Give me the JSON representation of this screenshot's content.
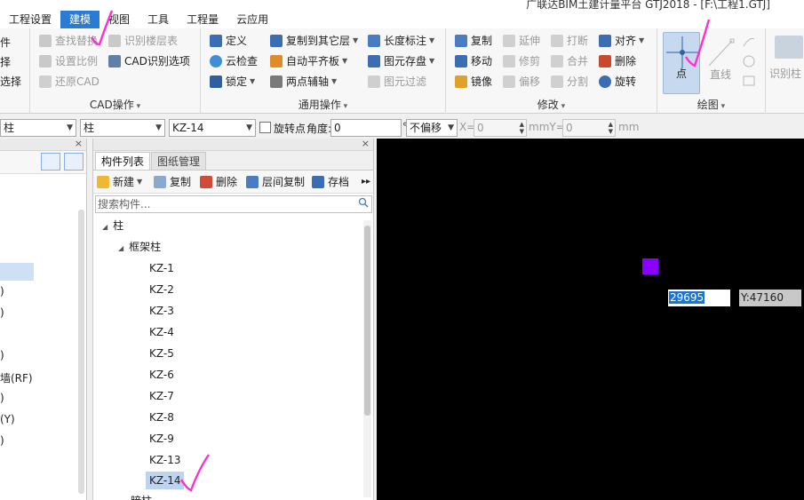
{
  "window": {
    "title": "广联达BIM土建计量平台 GTJ2018 - [F:\\工程1.GTJ]"
  },
  "menu": {
    "items": [
      "工程设置",
      "建模",
      "视图",
      "工具",
      "工程量",
      "云应用"
    ],
    "active": "建模"
  },
  "ribbon": {
    "cad": {
      "label": "CAD操作",
      "left_cut_1": "件",
      "left_cut_2": "择",
      "left_cut_3": "选择",
      "find_replace": "查找替换",
      "identify_floor": "识别楼层表",
      "set_ratio": "设置比例",
      "cad_options": "CAD识别选项",
      "restore_cad": "还原CAD"
    },
    "common": {
      "label": "通用操作",
      "define": "定义",
      "copy_to_floor": "复制到其它层",
      "length_mark": "长度标注",
      "cloud_check": "云检查",
      "auto_flat_slab": "自动平齐板",
      "element_storage": "图元存盘",
      "lock": "锁定",
      "two_point_axis": "两点辅轴",
      "element_filter": "图元过滤"
    },
    "modify": {
      "label": "修改",
      "copy": "复制",
      "extend": "延伸",
      "break": "打断",
      "align": "对齐",
      "move": "移动",
      "trim": "修剪",
      "merge": "合并",
      "delete": "删除",
      "mirror": "镜像",
      "offset": "偏移",
      "split": "分割",
      "rotate": "旋转"
    },
    "draw": {
      "label": "绘图",
      "point": "点",
      "line": "直线"
    },
    "identify_cut": "识别柱"
  },
  "property_bar": {
    "combo1": "柱",
    "combo2": "柱",
    "combo3": "KZ-14",
    "rotate_point": "旋转点",
    "angle_label": "角度:",
    "angle_value": "0",
    "degree": "°",
    "offset_mode": "不偏移",
    "x_label": "X=",
    "x_value": "0",
    "mm_y_label": "mmY=",
    "y_value": "0",
    "mm_label": "mm"
  },
  "left_panel": {
    "items": [
      ")",
      ")",
      ")",
      "墙(RF)",
      ")",
      "(Y)",
      ")"
    ]
  },
  "component_list": {
    "tabs": [
      "构件列表",
      "图纸管理"
    ],
    "active_tab": "构件列表",
    "toolbar": {
      "new": "新建",
      "copy": "复制",
      "delete": "删除",
      "floor_copy": "层间复制",
      "archive": "存档",
      "more": "▸▸"
    },
    "search_placeholder": "搜索构件...",
    "tree": {
      "root": "柱",
      "group": "框架柱",
      "items": [
        "KZ-1",
        "KZ-2",
        "KZ-3",
        "KZ-4",
        "KZ-5",
        "KZ-6",
        "KZ-7",
        "KZ-8",
        "KZ-9",
        "KZ-13",
        "KZ-14"
      ],
      "selected": "KZ-14",
      "next_cut": "暗柱"
    }
  },
  "canvas": {
    "x_coord": "29695",
    "y_coord": "Y:47160",
    "point_color": "#8a00ff"
  }
}
